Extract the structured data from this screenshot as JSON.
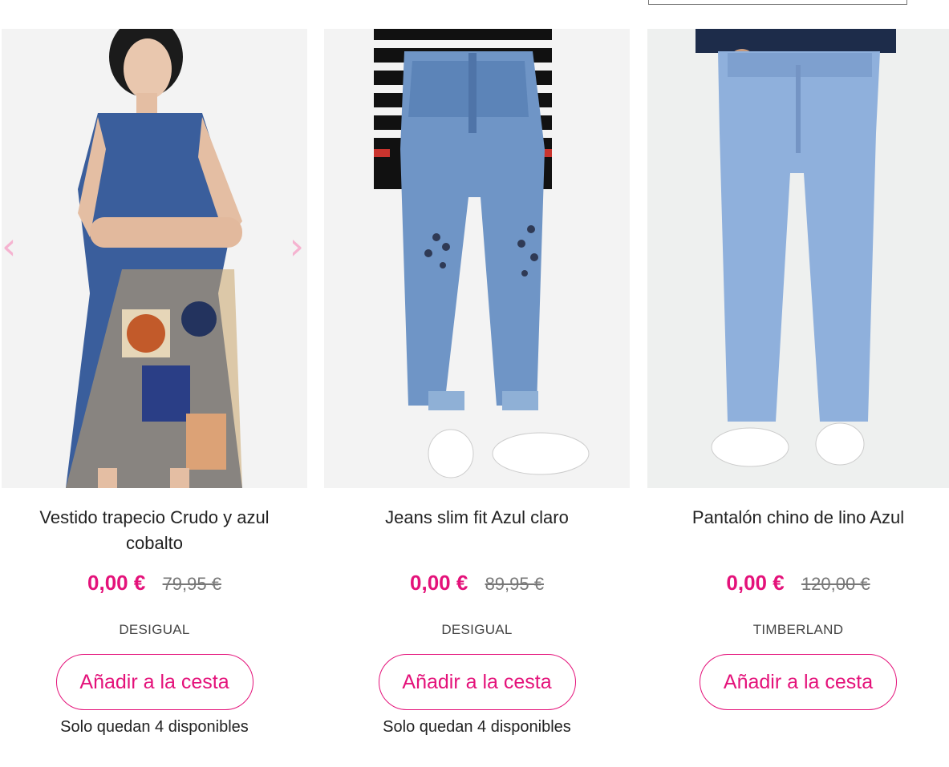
{
  "products": [
    {
      "title": "Vestido trapecio Crudo y azul cobalto",
      "price": "0,00 €",
      "old_price": "79,95 €",
      "brand": "DESIGUAL",
      "cart_label": "Añadir a la cesta",
      "stock": "Solo quedan 4 disponibles"
    },
    {
      "title": "Jeans slim fit Azul claro",
      "price": "0,00 €",
      "old_price": "89,95 €",
      "brand": "DESIGUAL",
      "cart_label": "Añadir a la cesta",
      "stock": "Solo quedan 4 disponibles"
    },
    {
      "title": "Pantalón chino de lino Azul",
      "price": "0,00 €",
      "old_price": "120,00 €",
      "brand": "TIMBERLAND",
      "cart_label": "Añadir a la cesta"
    }
  ],
  "carousel": {
    "prev_icon": "‹",
    "next_icon": "›"
  },
  "colors": {
    "accent": "#e4127a",
    "arrow": "#f5b3d0"
  }
}
